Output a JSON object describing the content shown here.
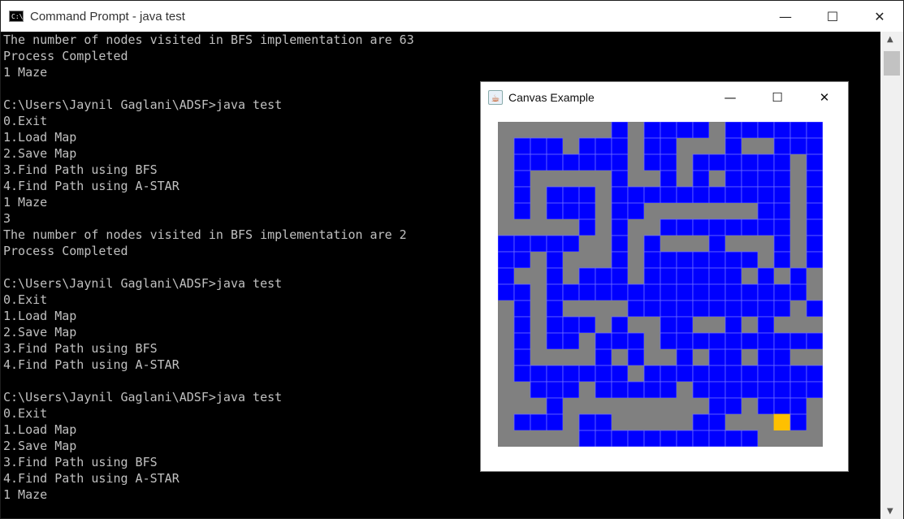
{
  "cmd_window": {
    "icon_text": "C:\\.",
    "title": "Command Prompt - java  test",
    "controls": {
      "minimize": "—",
      "maximize": "☐",
      "close": "✕"
    }
  },
  "console_lines": [
    "The number of nodes visited in BFS implementation are 63",
    "Process Completed",
    "1 Maze",
    "",
    "C:\\Users\\Jaynil Gaglani\\ADSF>java test",
    "0.Exit",
    "1.Load Map",
    "2.Save Map",
    "3.Find Path using BFS",
    "4.Find Path using A-STAR",
    "1 Maze",
    "3",
    "The number of nodes visited in BFS implementation are 2",
    "Process Completed",
    "",
    "C:\\Users\\Jaynil Gaglani\\ADSF>java test",
    "0.Exit",
    "1.Load Map",
    "2.Save Map",
    "3.Find Path using BFS",
    "4.Find Path using A-STAR",
    "",
    "C:\\Users\\Jaynil Gaglani\\ADSF>java test",
    "0.Exit",
    "1.Load Map",
    "2.Save Map",
    "3.Find Path using BFS",
    "4.Find Path using A-STAR",
    "1 Maze"
  ],
  "canvas_window": {
    "title": "Canvas Example",
    "icon_name": "java-icon",
    "controls": {
      "minimize": "—",
      "maximize": "☐",
      "close": "✕"
    }
  },
  "maze": {
    "rows": 20,
    "cols": 20,
    "colors": {
      "wall": "#808080",
      "open": "#0000ff",
      "target": "#ffc000",
      "gridline": "#6b6bff"
    },
    "target": [
      18,
      17
    ],
    "grid": [
      "WWWWWWWOWOOOOWOOOOOO",
      "WOOOWOOOWOOWWWOWWOOO",
      "WOOOOOOOWOOWOOOOOOWO",
      "WOWWWWWOWWOWOWOOOOWO",
      "WOWOOOWOOOOOOOOOOOWO",
      "WOWOOOWOOWWWWWWWOOWO",
      "WWWWWOWOWWOOOOOOOOWO",
      "OOOOOWWOWOWWWOWWWOWO",
      "OOWOWWWOWOOOOOOOWOWO",
      "OWWOWOOOWOOOOOOWOWOW",
      "OOWOOOOOOOOOOOOOOOOW",
      "WOWOWWWWOOOOOOOOOOWO",
      "WOWOOOWOWWOOWWOWOWWW",
      "WOWOOWOOOWOOOOOOOOOO",
      "WOWWWWOWOWWOWOOWOOWW",
      "WOOOOOOOWOOOOOOOOOOO",
      "WWOOOWOOOOOWOOOOOOOO",
      "WWWOWWWWWWWWWOOWOOOW",
      "WOOOWOOWWWWWOOWWWOOW",
      "WWWWWOOOOOOOOOOOWWWW"
    ]
  }
}
